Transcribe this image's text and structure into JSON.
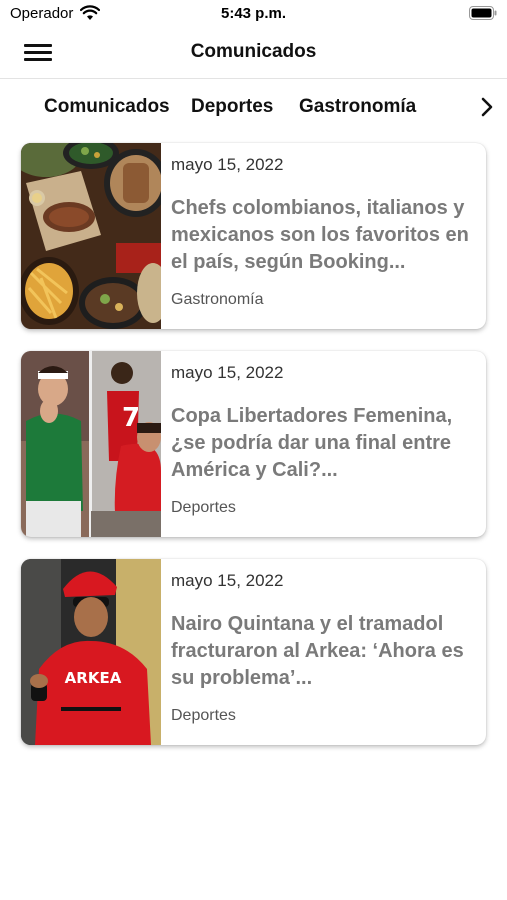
{
  "status": {
    "carrier": "Operador",
    "time": "5:43 p.m."
  },
  "nav": {
    "title": "Comunicados"
  },
  "tabs": [
    {
      "label": "Comunicados"
    },
    {
      "label": "Deportes"
    },
    {
      "label": "Gastronomía"
    }
  ],
  "articles": [
    {
      "date": "mayo 15, 2022",
      "title": "Chefs colombianos, italianos y mexicanos son los favoritos en el país, según Booking...",
      "category": "Gastronomía"
    },
    {
      "date": "mayo 15, 2022",
      "title": "Copa Libertadores Femenina, ¿se podría dar una final entre América y Cali?...",
      "category": "Deportes"
    },
    {
      "date": "mayo 15, 2022",
      "title": "Nairo Quintana y el tramadol fracturaron al Arkea: ‘Ahora es su problema’...",
      "category": "Deportes"
    }
  ],
  "photo3": {
    "jersey_text": "ARKEA"
  },
  "icons": {
    "wifi": "wifi-icon",
    "battery": "battery-icon",
    "menu": "hamburger-menu-icon",
    "next": "chevron-right-icon"
  }
}
